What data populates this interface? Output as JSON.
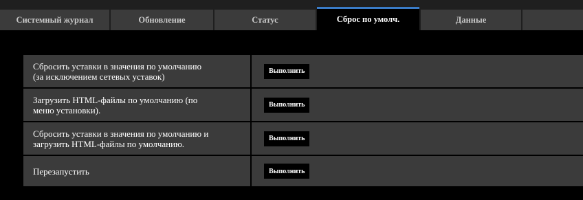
{
  "tabs": [
    {
      "label": "Системный журнал"
    },
    {
      "label": "Обновление"
    },
    {
      "label": "Статус"
    },
    {
      "label": "Сброс по умолч."
    },
    {
      "label": "Данные"
    },
    {
      "label": ""
    }
  ],
  "active_tab_index": 3,
  "colors": {
    "background": "#000000",
    "tab_bar": "#1f1f1f",
    "tab": "#3b3b3b",
    "active_tab_accent": "#3a7cc8",
    "row": "#3b3b3b",
    "button": "#000000",
    "text": "#ffffff"
  },
  "rows": [
    {
      "label_line1": "Сбросить уставки в значения по умолчанию",
      "label_line2": "(за исключением сетевых уставок)",
      "button": "Выполнить"
    },
    {
      "label_line1": "Загрузить HTML-файлы по умолчанию (по",
      "label_line2": "меню установки).",
      "button": "Выполнить"
    },
    {
      "label_line1": "Сбросить уставки в значения по умолчанию и",
      "label_line2": "загрузить HTML-файлы по умолчанию.",
      "button": "Выполнить"
    },
    {
      "label_line1": "Перезапустить",
      "label_line2": "",
      "button": "Выполнить"
    }
  ]
}
